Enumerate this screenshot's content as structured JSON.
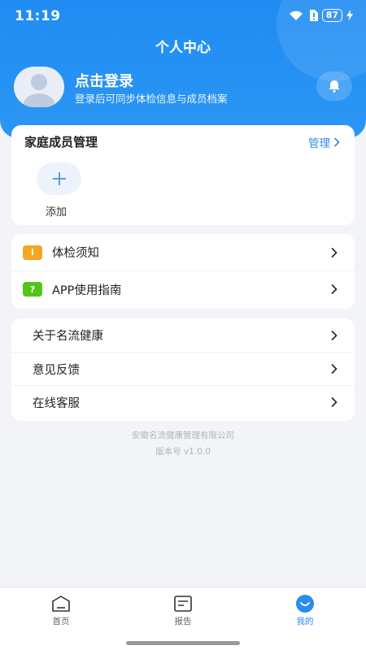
{
  "status_bar": {
    "time": "11:19",
    "battery": "87"
  },
  "header": {
    "title": "个人中心",
    "user_name": "点击登录",
    "user_sub": "登录后可同步体检信息与成员档案"
  },
  "family": {
    "title": "家庭成员管理",
    "action": "管理",
    "add_label": "添加"
  },
  "menu_group_1": [
    {
      "label": "体检须知",
      "icon": "info-icon",
      "icon_text": "i",
      "color": "#f5a623"
    },
    {
      "label": "APP使用指南",
      "icon": "help-icon",
      "icon_text": "?",
      "color": "#52c41a"
    }
  ],
  "menu_group_2": [
    {
      "label": "关于名流健康"
    },
    {
      "label": "意见反馈"
    },
    {
      "label": "在线客服"
    }
  ],
  "footer": {
    "company": "安徽名流健康管理有限公司",
    "version": "版本号 v1.0.0"
  },
  "tabbar": {
    "home": "首页",
    "report": "报告",
    "me": "我的"
  },
  "colors": {
    "primary": "#2a8bf0",
    "header": "#1f8cf2"
  }
}
